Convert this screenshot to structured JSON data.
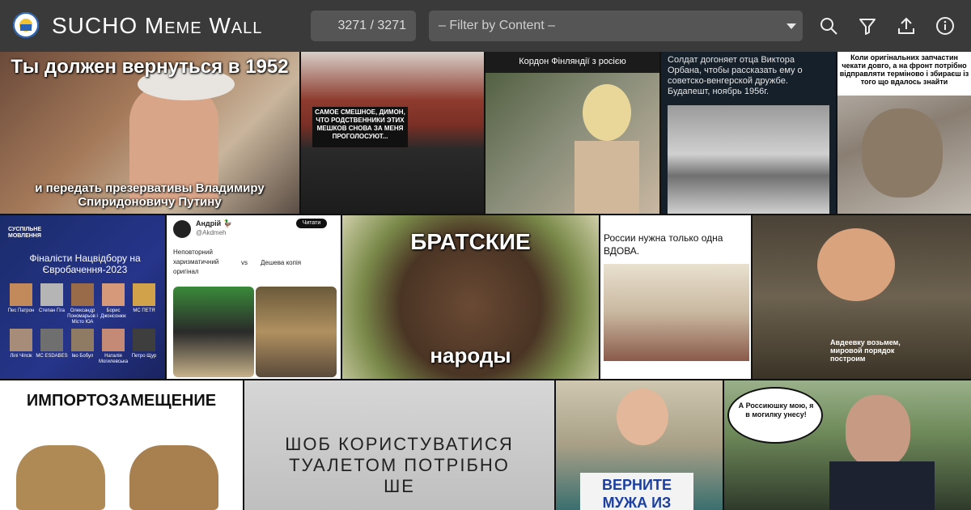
{
  "header": {
    "title": "SUCHO Meme Wall",
    "counter": "3271 / 3271",
    "filter_placeholder": "– Filter by Content –",
    "icons": [
      "search-icon",
      "filter-icon",
      "upload-icon",
      "info-icon"
    ],
    "colors": {
      "bar": "#3a3a3a",
      "control": "#555555",
      "text": "#ffffff"
    }
  },
  "memes": [
    {
      "id": "m1",
      "top": "Ты должен вернуться в 1952",
      "bottom": "и передать презервативы Владимиру Спиридоновичу Путину"
    },
    {
      "id": "m2",
      "caption": "САМОЕ СМЕШНОЕ, ДИМОН, ЧТО РОДСТВЕННИКИ ЭТИХ МЕШКОВ СНОВА ЗА МЕНЯ ПРОГОЛОСУЮТ..."
    },
    {
      "id": "m3",
      "caption": "Кордон Фінляндії з росією"
    },
    {
      "id": "m4",
      "caption": "Солдат догоняет отца Виктора Орбана, чтобы рассказать ему о советско-венгерской дружбе. Будапешт, ноябрь 1956г."
    },
    {
      "id": "m5",
      "caption": "Коли оригінальних запчастин чекати довго, а на фронт потрібно відправляти терміново і збираєш із того що вдалось знайти"
    },
    {
      "id": "m6",
      "brand": "СУСПІЛЬНЕ МОВЛЕННЯ",
      "title": "Фіналісти Нацвідбору на Євробачення-2023",
      "names": [
        "Пес Патрон",
        "Степан Гіга",
        "Олександр Пономарьов і Місто ЮА",
        "Борис Джонсонюк",
        "МС ПЕТЯ",
        "Лілі Чіпсік",
        "МС ESDABES",
        "Іво Бобул",
        "Наталія Могилевська",
        "Петро Щур"
      ]
    },
    {
      "id": "m7",
      "user": "Андрій 🦆",
      "handle": "@Akdmeh",
      "follow": "Читати",
      "left": "Неповторний харизматичний оригінал",
      "vs": "vs",
      "right": "Дешева копія"
    },
    {
      "id": "m8",
      "top": "БРАТСКИЕ",
      "bottom": "народы"
    },
    {
      "id": "m9",
      "caption": "России нужна только одна ВДОВА."
    },
    {
      "id": "m10",
      "caption": "Авдеевку возьмем, мировой порядок построим"
    },
    {
      "id": "m11",
      "caption": "ИМПОРТОЗАМЕЩЕНИЕ"
    },
    {
      "id": "m12",
      "caption": "ШОБ КОРИСТУВАТИСЯ ТУАЛЕТОМ ПОТРІБНО ШЕ"
    },
    {
      "id": "m13",
      "caption": "ВЕРНИТЕ МУЖА ИЗ"
    },
    {
      "id": "m14",
      "caption": "А Россиюшку мою, я в могилку унесу!"
    }
  ]
}
